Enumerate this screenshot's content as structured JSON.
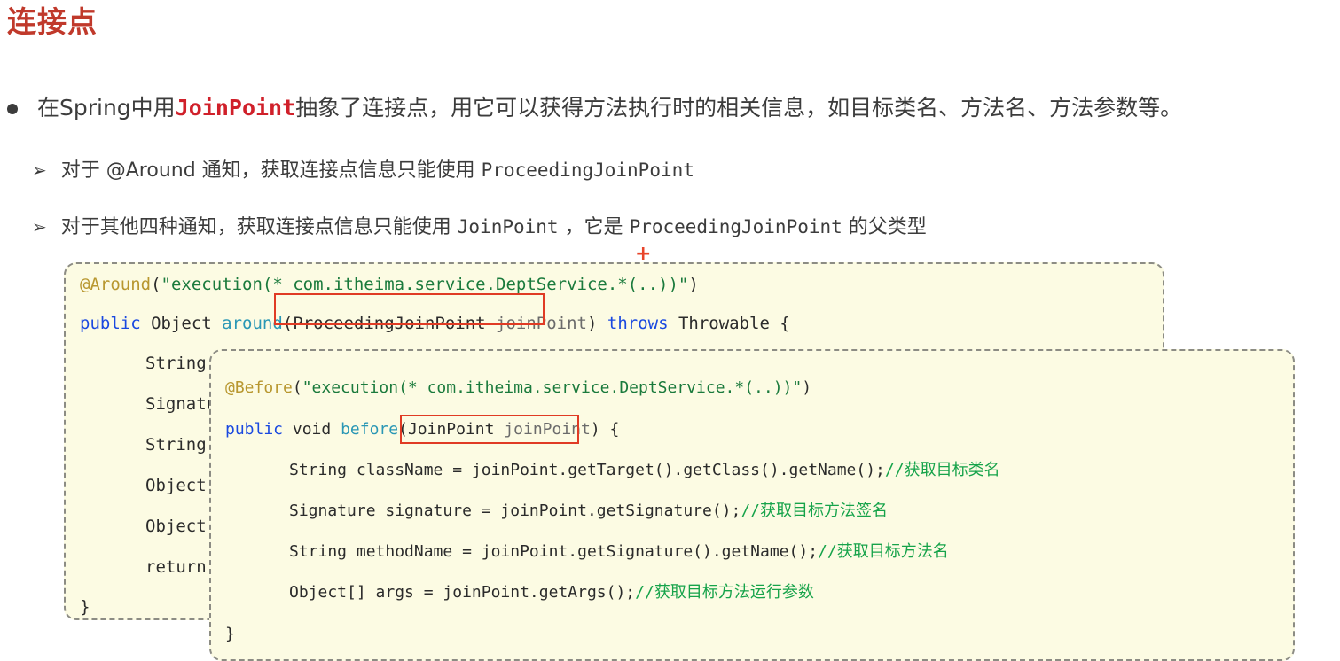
{
  "page": {
    "title": "连接点",
    "title_color": "#c0392b",
    "background": "#ffffff"
  },
  "bullets": {
    "main": {
      "marker": "bullet-dot",
      "prefix": "在Spring中用",
      "keyword": "JoinPoint",
      "suffix": "抽象了连接点，用它可以获得方法执行时的相关信息，如目标类名、方法名、方法参数等。"
    },
    "sub": [
      {
        "marker": "➢",
        "text_before": "对于 @Around 通知，获取连接点信息只能使用  ",
        "code": "ProceedingJoinPoint",
        "text_after": ""
      },
      {
        "marker": "➢",
        "text_before": "对于其他四种通知，获取连接点信息只能使用 ",
        "code": "JoinPoint",
        "text_mid": " ，它是 ",
        "code2": "ProceedingJoinPoint",
        "text_after": " 的父类型"
      }
    ]
  },
  "markers": {
    "plus": "+",
    "plus_color": "#e8442a"
  },
  "code_around": {
    "background": "#fcfbe3",
    "border_color": "#8c8c84",
    "lines": [
      {
        "annotation": "@Around",
        "paren_open": "(",
        "string": "\"execution(* com.itheima.service.DeptService.*(..))\"",
        "paren_close": ")"
      },
      {
        "kw1": "public",
        "type1": " Object ",
        "method": "around",
        "paren_open": "(",
        "param_type": "ProceedingJoinPoint",
        "param_name": " joinPoint",
        "paren_close": ")",
        "kw2": " throws ",
        "type2": "Throwable {"
      },
      {
        "text": "String"
      },
      {
        "text": "Signatu"
      },
      {
        "text": "String"
      },
      {
        "text": "Object["
      },
      {
        "text": "Object"
      },
      {
        "text": "return"
      },
      {
        "text": "}"
      }
    ]
  },
  "code_before": {
    "background": "#fcfbe3",
    "border_color": "#8c8c84",
    "lines": [
      {
        "annotation": "@Before",
        "paren_open": "(",
        "string": "\"execution(* com.itheima.service.DeptService.*(..))\"",
        "paren_close": ")"
      },
      {
        "kw1": "public",
        "type1": " void ",
        "method": "before",
        "paren_open": "(",
        "param_type": "JoinPoint",
        "param_name": " joinPoint",
        "paren_close": ")",
        "brace": " {"
      },
      {
        "code": "String className = joinPoint.getTarget().getClass().getName();",
        "comment": "//获取目标类名"
      },
      {
        "code": "Signature signature = joinPoint.getSignature();",
        "comment": "//获取目标方法签名"
      },
      {
        "code": "String methodName = joinPoint.getSignature().getName();",
        "comment": "//获取目标方法名"
      },
      {
        "code": "Object[] args = joinPoint.getArgs();",
        "comment": "//获取目标方法运行参数"
      },
      {
        "text": "}"
      }
    ]
  },
  "highlights": [
    {
      "name": "proceeding-joinpoint-param",
      "color": "#e03b24"
    },
    {
      "name": "joinpoint-param",
      "color": "#e03b24"
    }
  ],
  "colors": {
    "annotation": "#b8972f",
    "string": "#1a7a3c",
    "keyword": "#1a49e0",
    "method": "#2a97b5",
    "comment": "#16a34a",
    "text": "#3c3c3c",
    "red_keyword": "#d0202a"
  }
}
